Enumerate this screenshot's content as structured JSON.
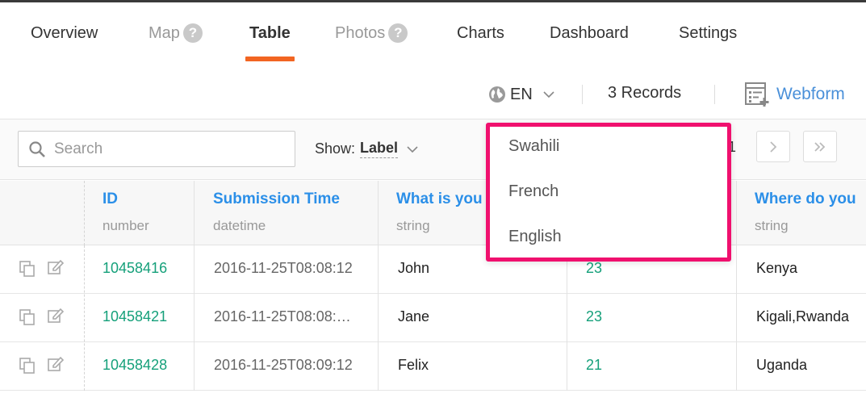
{
  "tabs": [
    {
      "label": "Overview"
    },
    {
      "label": "Map"
    },
    {
      "label": "Table"
    },
    {
      "label": "Photos"
    },
    {
      "label": "Charts"
    },
    {
      "label": "Dashboard"
    },
    {
      "label": "Settings"
    }
  ],
  "help_glyph": "?",
  "language": {
    "current": "EN",
    "options": [
      "Swahili",
      "French",
      "English"
    ]
  },
  "records": "3 Records",
  "webform": "Webform",
  "search": {
    "placeholder": "Search",
    "value": ""
  },
  "show": {
    "label": "Show:",
    "value": "Label"
  },
  "pagination": {
    "current_page": "1"
  },
  "columns": [
    {
      "name": "ID",
      "type": "number"
    },
    {
      "name": "Submission Time",
      "type": "datetime"
    },
    {
      "name": "What is you",
      "type": "string"
    },
    {
      "name": "",
      "type": ""
    },
    {
      "name": "Where do you",
      "type": "string"
    }
  ],
  "rows": [
    {
      "id": "10458416",
      "time": "2016-11-25T08:08:12",
      "name": "John",
      "age": "23",
      "place": "Kenya"
    },
    {
      "id": "10458421",
      "time": "2016-11-25T08:08:…",
      "name": "Jane",
      "age": "23",
      "place": "Kigali,Rwanda"
    },
    {
      "id": "10458428",
      "time": "2016-11-25T08:09:12",
      "name": "Felix",
      "age": "21",
      "place": "Uganda"
    }
  ],
  "colors": {
    "accent_underline": "#f26522",
    "link_blue": "#2b8fe8",
    "id_green": "#15a07a",
    "dropdown_highlight": "#f0106e"
  }
}
